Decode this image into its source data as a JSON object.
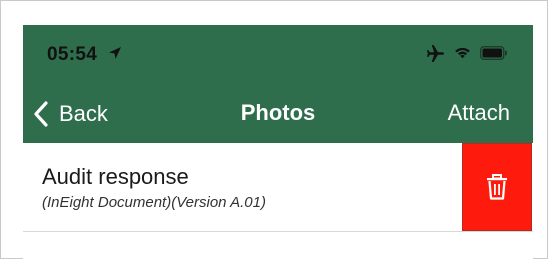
{
  "status_bar": {
    "time": "05:54",
    "icons": [
      "location-arrow-icon",
      "airplane-icon",
      "wifi-icon",
      "battery-icon"
    ]
  },
  "nav": {
    "back_label": "Back",
    "title": "Photos",
    "attach_label": "Attach"
  },
  "list": {
    "items": [
      {
        "title": "Audit response",
        "subtitle": "(InEight Document)(Version  A.01)",
        "action_icon": "trash-icon"
      }
    ]
  },
  "colors": {
    "header_bg": "#2f6e4d",
    "delete_bg": "#ff1a0e",
    "text": "#1a1a1a"
  }
}
